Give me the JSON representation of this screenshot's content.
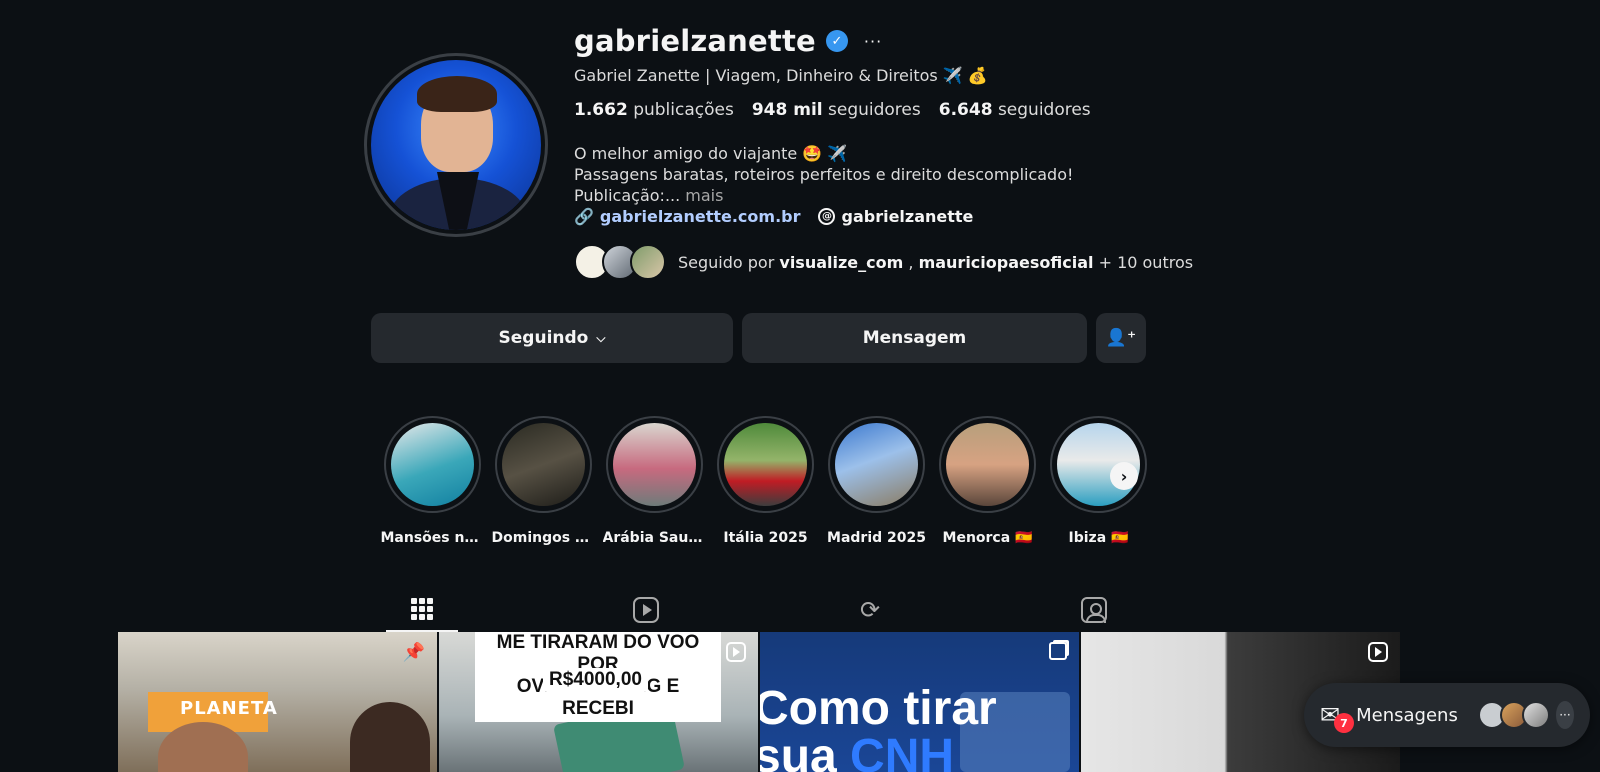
{
  "profile": {
    "username": "gabrielzanette",
    "verified_icon": "verified-badge-icon",
    "full_name": "Gabriel Zanette | Viagem, Dinheiro & Direitos ✈️ 💰",
    "stats": {
      "posts_count": "1.662",
      "posts_label": "publicações",
      "followers_count": "948 mil",
      "followers_label": "seguidores",
      "following_count": "6.648",
      "following_label": "seguidores"
    },
    "bio": {
      "line1": "O melhor amigo do viajante 🤩 ✈️",
      "line2": "Passagens baratas, roteiros perfeitos e direito descomplicado!",
      "line3": "Publicação:...",
      "more": " mais"
    },
    "link": "gabrielzanette.com.br",
    "threads_handle": "gabrielzanette",
    "followed_by": {
      "prefix": "Seguido por ",
      "user1": "visualize_com",
      "separator": " , ",
      "user2": "mauriciopaesoficial",
      "suffix": " + 10 outros"
    }
  },
  "actions": {
    "following_label": "Seguindo",
    "message_label": "Mensagem",
    "add_person_icon": "add-person-icon"
  },
  "highlights": [
    {
      "label": "Mansões no E..."
    },
    {
      "label": "Domingos M..."
    },
    {
      "label": "Arábia Saudita"
    },
    {
      "label": "Itália 2025"
    },
    {
      "label": "Madrid 2025"
    },
    {
      "label": "Menorca 🇪🇸"
    },
    {
      "label": "Ibiza 🇪🇸"
    }
  ],
  "tabs": [
    {
      "name": "posts",
      "icon": "grid-icon"
    },
    {
      "name": "reels",
      "icon": "reels-icon"
    },
    {
      "name": "reposts",
      "icon": "repost-icon"
    },
    {
      "name": "tagged",
      "icon": "tagged-icon"
    }
  ],
  "posts": {
    "p1_sign": "PLANETA",
    "p2_caption_line1": "ME TIRARAM DO VOO POR",
    "p2_caption_line2": "OVERBOOKING E RECEBI",
    "p2_caption_line3": "R$4000,00",
    "p3_line1": "Como tirar",
    "p3_line2_a": "sua ",
    "p3_line2_b": "CNH"
  },
  "messages_bar": {
    "label": "Mensagens",
    "unread_count": "7"
  },
  "colors": {
    "background": "#0c1014",
    "button": "#25292e",
    "link": "#b2cdff",
    "verified": "#3797f0",
    "badge": "#ff3040"
  }
}
